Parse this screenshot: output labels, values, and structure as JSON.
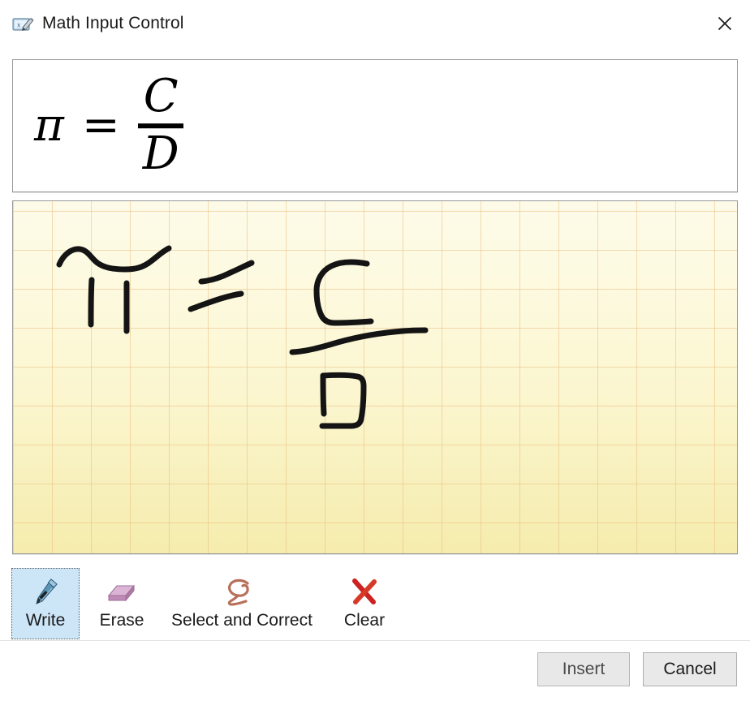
{
  "window": {
    "title": "Math Input Control",
    "icon": "math-input-tablet-pen-icon",
    "close_icon": "close-icon"
  },
  "preview": {
    "name": "recognition-preview",
    "equation_text": "π = C/D",
    "pi": "π",
    "equals": "=",
    "numerator": "C",
    "denominator": "D"
  },
  "ink_canvas": {
    "name": "ink-writing-area",
    "background_top": "#fdfbe8",
    "background_bottom": "#f5ecad",
    "grid_color": "#ebbe82",
    "grid_size": 48,
    "stroke_color": "#111111",
    "stroke_description": "Handwritten equation: pi equals C over D"
  },
  "tools": [
    {
      "id": "write",
      "label": "Write",
      "icon": "pen-icon",
      "selected": true
    },
    {
      "id": "erase",
      "label": "Erase",
      "icon": "eraser-icon",
      "selected": false
    },
    {
      "id": "select",
      "label": "Select and Correct",
      "icon": "lasso-icon",
      "selected": false
    },
    {
      "id": "clear",
      "label": "Clear",
      "icon": "red-x-icon",
      "selected": false
    }
  ],
  "footer": {
    "insert_label": "Insert",
    "cancel_label": "Cancel"
  },
  "colors": {
    "selection_highlight": "#cde6f7",
    "button_face": "#e9e9e9",
    "panel_border": "#9a9a9a",
    "clear_icon": "#cc2222",
    "eraser_icon": "#c79ac2",
    "lasso_icon": "#b8705a"
  }
}
